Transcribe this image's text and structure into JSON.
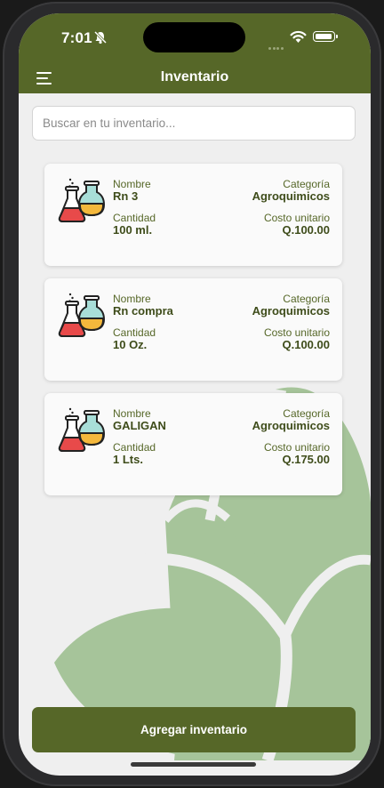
{
  "status_bar": {
    "time": "7:01"
  },
  "header": {
    "title": "Inventario",
    "menu_icon": "menu-icon"
  },
  "search": {
    "placeholder": "Buscar en tu inventario..."
  },
  "labels": {
    "name": "Nombre",
    "category": "Categoría",
    "quantity": "Cantidad",
    "unit_cost": "Costo unitario"
  },
  "items": [
    {
      "name": "Rn 3",
      "category": "Agroquimicos",
      "quantity": "100 ml.",
      "unit_cost": "Q.100.00",
      "icon": "lab-flasks-icon"
    },
    {
      "name": "Rn compra",
      "category": "Agroquimicos",
      "quantity": "10 Oz.",
      "unit_cost": "Q.100.00",
      "icon": "lab-flasks-icon"
    },
    {
      "name": "GALIGAN",
      "category": "Agroquimicos",
      "quantity": "1 Lts.",
      "unit_cost": "Q.175.00",
      "icon": "lab-flasks-icon"
    }
  ],
  "add_button": {
    "label": "Agregar inventario"
  },
  "colors": {
    "primary": "#566728",
    "background": "#efefef",
    "leaf": "#a6c49a"
  }
}
